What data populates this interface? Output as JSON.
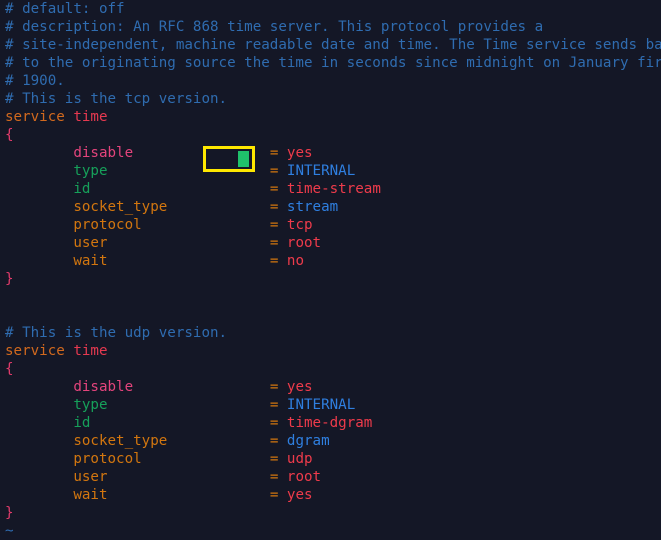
{
  "editor": {
    "background_color": "#141726",
    "filetype": "xinetd-config",
    "cursor": {
      "visible": true,
      "color": "#1fc26b",
      "line": 10,
      "column": 28,
      "on_token": "yes"
    },
    "highlight": {
      "visible": true,
      "border_color": "#ffe800",
      "target_text": "yes",
      "target_key": "disable",
      "target_block": "tcp"
    },
    "colors": {
      "comment": "#2f6cb0",
      "keyword": "#d2691e",
      "service_name": "#e63950",
      "brace": "#e23b6b",
      "attr_pink": "#e4447c",
      "attr_green": "#16a05a",
      "attr_orange": "#d2760f",
      "equals": "#d2760f",
      "value_red": "#ee3b4b",
      "value_blue": "#2f7fe0",
      "tilde": "#2f6cb0"
    }
  },
  "comments": {
    "l1": "# default: off",
    "l2": "# description: An RFC 868 time server. This protocol provides a",
    "l3": "# site-independent, machine readable date and time. The Time service sends back",
    "l4": "# to the originating source the time in seconds since midnight on January first",
    "l5": "# 1900.",
    "l6": "# This is the tcp version.",
    "l_udp": "# This is the udp version."
  },
  "syntax": {
    "service_keyword": "service",
    "service_name": "time",
    "brace_open": "{",
    "brace_close": "}",
    "equals": "=",
    "tilde": "~",
    "indent": "        "
  },
  "blocks": [
    {
      "id": "tcp-block",
      "comment": "# This is the tcp version.",
      "keyword": "service",
      "name": "time",
      "entries": [
        {
          "key": "disable",
          "value": "yes",
          "key_color": "attr_pink",
          "value_color": "value_red"
        },
        {
          "key": "type",
          "value": "INTERNAL",
          "key_color": "attr_green",
          "value_color": "value_blue"
        },
        {
          "key": "id",
          "value": "time-stream",
          "key_color": "attr_green",
          "value_color": "value_red"
        },
        {
          "key": "socket_type",
          "value": "stream",
          "key_color": "attr_orange",
          "value_color": "value_blue"
        },
        {
          "key": "protocol",
          "value": "tcp",
          "key_color": "attr_orange",
          "value_color": "value_red"
        },
        {
          "key": "user",
          "value": "root",
          "key_color": "attr_orange",
          "value_color": "value_red"
        },
        {
          "key": "wait",
          "value": "no",
          "key_color": "attr_orange",
          "value_color": "value_red"
        }
      ]
    },
    {
      "id": "udp-block",
      "comment": "# This is the udp version.",
      "keyword": "service",
      "name": "time",
      "entries": [
        {
          "key": "disable",
          "value": "yes",
          "key_color": "attr_pink",
          "value_color": "value_red"
        },
        {
          "key": "type",
          "value": "INTERNAL",
          "key_color": "attr_green",
          "value_color": "value_blue"
        },
        {
          "key": "id",
          "value": "time-dgram",
          "key_color": "attr_green",
          "value_color": "value_red"
        },
        {
          "key": "socket_type",
          "value": "dgram",
          "key_color": "attr_orange",
          "value_color": "value_blue"
        },
        {
          "key": "protocol",
          "value": "udp",
          "key_color": "attr_orange",
          "value_color": "value_red"
        },
        {
          "key": "user",
          "value": "root",
          "key_color": "attr_orange",
          "value_color": "value_red"
        },
        {
          "key": "wait",
          "value": "yes",
          "key_color": "attr_orange",
          "value_color": "value_red"
        }
      ]
    }
  ]
}
